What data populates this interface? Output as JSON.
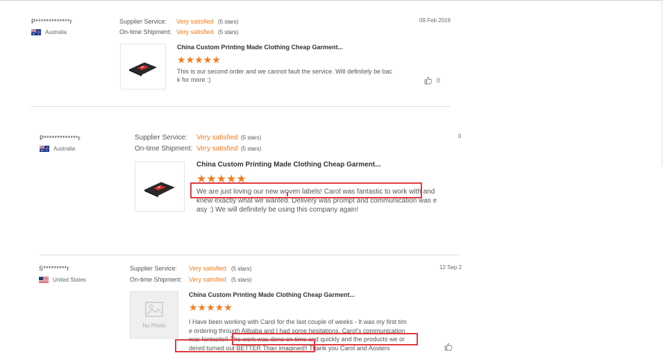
{
  "reviews": [
    {
      "user": "P*************r",
      "country": "Australia",
      "flag": "australia-flag",
      "supplier_label": "Supplier Service:",
      "supplier_value": "Very satisfied",
      "supplier_stars": "(5 stars)",
      "shipment_label": "On-time Shipment:",
      "shipment_value": "Very satisfied",
      "shipment_stars": "(5 stars)",
      "date": "09 Feb 2019",
      "product_title": "China Custom Printing Made Clothing Cheap Garment...",
      "rating_stars": "★★★★★",
      "text_lines": [
        "This is our second order and we cannot fault the service.  Will definitely be bac",
        "k for more :)"
      ],
      "likes": "0"
    },
    {
      "user": "P*************r",
      "country": "Australia",
      "flag": "australia-flag",
      "supplier_label": "Supplier Service:",
      "supplier_value": "Very satisfied",
      "supplier_stars": "(5 stars)",
      "shipment_label": "On-time Shipment:",
      "shipment_value": "Very satisfied",
      "shipment_stars": "(5 stars)",
      "date": "0",
      "product_title": "China Custom Printing Made Clothing Cheap Garment...",
      "rating_stars": "★★★★★",
      "text_lines": [
        "We are just loving our new woven labels! Carol was fantastic to work with and",
        "knew exactly what we wanted. Delivery was prompt and communication was e",
        "asy :)  We will definitely be using this company again!"
      ]
    },
    {
      "user": "S*********r",
      "country": "United States",
      "flag": "united-states-flag",
      "supplier_label": "Supplier Service:",
      "supplier_value": "Very satisfied",
      "supplier_stars": "(5 stars)",
      "shipment_label": "On-time Shipment:",
      "shipment_value": "Very satisfied",
      "shipment_stars": "(5 stars)",
      "date": "12 Sep 2",
      "product_title": "China Custom Printing Made Clothing Cheap Garment...",
      "no_photo": "No Photo",
      "rating_stars": "★★★★★",
      "text_lines": [
        "I Have been working with Carol for the last couple of weeks - It was my first tim",
        "e ordering through Alibaba and I had some hesitations. Carol's communication",
        "was fantastic!! The work was done on time and quickly and the products we or",
        "dered turned out BETTER Than imagined!! Thank you Carol  and Aosters"
      ]
    }
  ],
  "colors": {
    "accent": "#f37b1d",
    "highlight": "#e0393e"
  }
}
